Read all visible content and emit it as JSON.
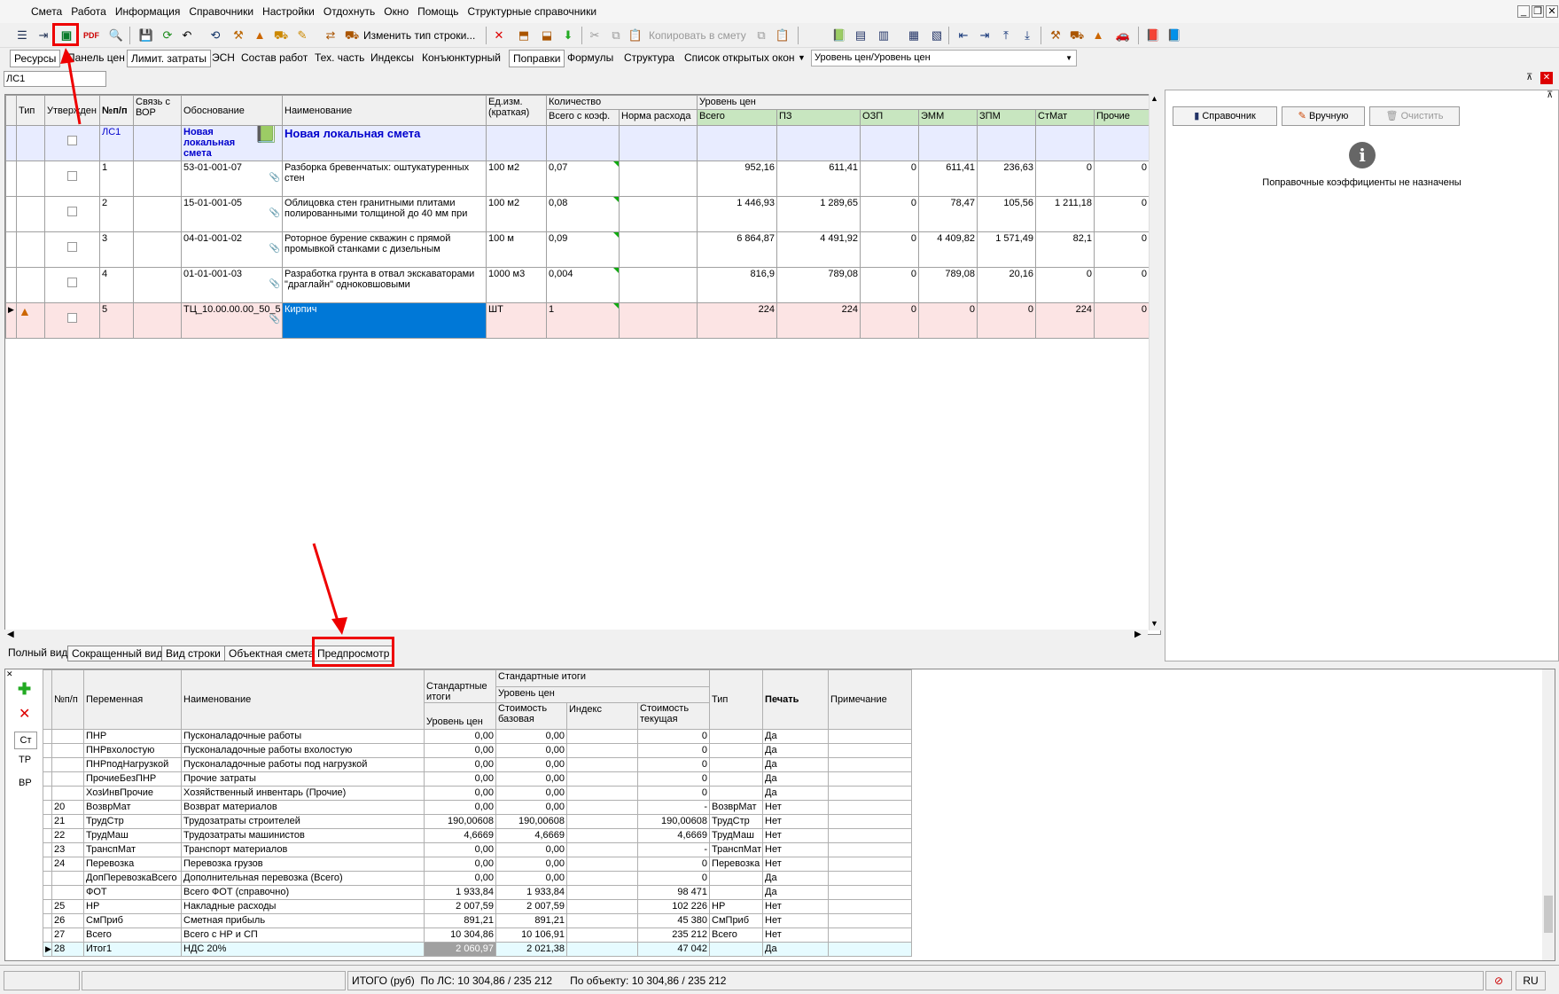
{
  "menu": [
    "Смета",
    "Работа",
    "Информация",
    "Справочники",
    "Настройки",
    "Отдохнуть",
    "Окно",
    "Помощь",
    "Структурные справочники"
  ],
  "toolbar1": {
    "change_row_type": "Изменить тип строки...",
    "copy_to_estimate": "Копировать в смету"
  },
  "toolbar2": {
    "tabs": [
      "Ресурсы",
      "Панель цен",
      "Лимит. затраты",
      "ЭСН",
      "Состав работ",
      "Тех. часть",
      "Индексы",
      "Конъюнктурный",
      "Поправки",
      "Формулы",
      "Структура",
      "Список открытых окон"
    ],
    "price_level": "Уровень цен/Уровень цен"
  },
  "address": "ЛС1",
  "grid": {
    "headers": {
      "type": "Тип",
      "approved": "Утвержден",
      "num": "№п/п",
      "bor": "Связь с ВОР",
      "basis": "Обоснование",
      "name": "Наименование",
      "unit": "Ед.изм. (краткая)",
      "qty": "Количество",
      "qty_total": "Всего с коэф.",
      "qty_norm": "Норма расхода",
      "level": "Уровень цен",
      "total": "Всего",
      "pz": "ПЗ",
      "ozp": "ОЗП",
      "emm": "ЭММ",
      "zpm": "ЗПМ",
      "stmat": "СтМат",
      "other": "Прочие"
    },
    "header_row": {
      "num": "ЛС1",
      "basis": "Новая локальная смета",
      "name": "Новая локальная смета"
    },
    "rows": [
      {
        "num": "1",
        "basis": "53-01-001-07",
        "name": "Разборка бревенчатых: оштукатуренных стен",
        "unit": "100 м2",
        "qty": "0,07",
        "total": "952,16",
        "pz": "611,41",
        "ozp": "0",
        "emm": "611,41",
        "zpm": "236,63",
        "stmat": "0",
        "other": "0"
      },
      {
        "num": "2",
        "basis": "15-01-001-05",
        "name": "Облицовка стен гранитными плитами полированными толщиной до 40 мм при",
        "unit": "100 м2",
        "qty": "0,08",
        "total": "1 446,93",
        "pz": "1 289,65",
        "ozp": "0",
        "emm": "78,47",
        "zpm": "105,56",
        "stmat": "1 211,18",
        "other": "0"
      },
      {
        "num": "3",
        "basis": "04-01-001-02",
        "name": "Роторное бурение скважин с прямой промывкой станками с дизельным",
        "unit": "100 м",
        "qty": "0,09",
        "total": "6 864,87",
        "pz": "4 491,92",
        "ozp": "0",
        "emm": "4 409,82",
        "zpm": "1 571,49",
        "stmat": "82,1",
        "other": "0"
      },
      {
        "num": "4",
        "basis": "01-01-001-03",
        "name": "Разработка грунта в отвал экскаваторами \"драглайн\" одноковшовыми",
        "unit": "1000 м3",
        "qty": "0,004",
        "total": "816,9",
        "pz": "789,08",
        "ozp": "0",
        "emm": "789,08",
        "zpm": "20,16",
        "stmat": "0",
        "other": "0"
      },
      {
        "num": "5",
        "basis": "ТЦ_10.00.00.00_50_5",
        "name": "Кирпич",
        "unit": "ШТ",
        "qty": "1",
        "total": "224",
        "pz": "224",
        "ozp": "0",
        "emm": "0",
        "zpm": "0",
        "stmat": "224",
        "other": "0"
      }
    ]
  },
  "bottom_tabs": [
    "Полный вид",
    "Сокращенный вид",
    "Вид строки",
    "Объектная смета",
    "Предпросмотр"
  ],
  "right_panel": {
    "btn_ref": "Справочник",
    "btn_manual": "Вручную",
    "btn_clear": "Очистить",
    "message": "Поправочные коэффициенты не назначены"
  },
  "side_tabs": [
    "Ст",
    "ТР",
    "ВР"
  ],
  "btable": {
    "headers": {
      "num": "№п/п",
      "var": "Переменная",
      "name": "Наименование",
      "std": "Стандартные итоги",
      "std_level": "Уровень цен",
      "std2": "Стандартные итоги",
      "level2": "Уровень цен",
      "base": "Стоимость базовая",
      "index": "Индекс",
      "current": "Стоимость текущая",
      "type": "Тип",
      "print": "Печать",
      "note": "Примечание"
    },
    "rows": [
      {
        "num": "",
        "var": "ПНР",
        "name": "Пусконаладочные работы",
        "std": "0,00",
        "base": "0,00",
        "index": "",
        "current": "0",
        "type": "",
        "print": "Да"
      },
      {
        "num": "",
        "var": "ПНРвхолостую",
        "name": "Пусконаладочные работы вхолостую",
        "std": "0,00",
        "base": "0,00",
        "index": "",
        "current": "0",
        "type": "",
        "print": "Да"
      },
      {
        "num": "",
        "var": "ПНРподНагрузкой",
        "name": "Пусконаладочные работы под нагрузкой",
        "std": "0,00",
        "base": "0,00",
        "index": "",
        "current": "0",
        "type": "",
        "print": "Да"
      },
      {
        "num": "",
        "var": "ПрочиеБезПНР",
        "name": "Прочие затраты",
        "std": "0,00",
        "base": "0,00",
        "index": "",
        "current": "0",
        "type": "",
        "print": "Да"
      },
      {
        "num": "",
        "var": "ХозИнвПрочие",
        "name": "Хозяйственный инвентарь (Прочие)",
        "std": "0,00",
        "base": "0,00",
        "index": "",
        "current": "0",
        "type": "",
        "print": "Да"
      },
      {
        "num": "20",
        "var": "ВозврМат",
        "name": "Возврат материалов",
        "std": "0,00",
        "base": "0,00",
        "index": "",
        "current": "-",
        "type": "ВозврМат",
        "print": "Нет"
      },
      {
        "num": "21",
        "var": "ТрудСтр",
        "name": "Трудозатраты строителей",
        "std": "190,00608",
        "base": "190,00608",
        "index": "",
        "current": "190,00608",
        "type": "ТрудСтр",
        "print": "Нет"
      },
      {
        "num": "22",
        "var": "ТрудМаш",
        "name": "Трудозатраты машинистов",
        "std": "4,6669",
        "base": "4,6669",
        "index": "",
        "current": "4,6669",
        "type": "ТрудМаш",
        "print": "Нет"
      },
      {
        "num": "23",
        "var": "ТранспМат",
        "name": "Транспорт материалов",
        "std": "0,00",
        "base": "0,00",
        "index": "",
        "current": "-",
        "type": "ТранспМат",
        "print": "Нет"
      },
      {
        "num": "24",
        "var": "Перевозка",
        "name": "Перевозка грузов",
        "std": "0,00",
        "base": "0,00",
        "index": "",
        "current": "0",
        "type": "Перевозка",
        "print": "Нет"
      },
      {
        "num": "",
        "var": "ДопПеревозкаВсего",
        "name": "Дополнительная перевозка (Всего)",
        "std": "0,00",
        "base": "0,00",
        "index": "",
        "current": "0",
        "type": "",
        "print": "Да"
      },
      {
        "num": "",
        "var": "ФОТ",
        "name": "Всего ФОТ (справочно)",
        "std": "1 933,84",
        "base": "1 933,84",
        "index": "",
        "current": "98 471",
        "type": "",
        "print": "Да"
      },
      {
        "num": "25",
        "var": "НР",
        "name": "Накладные расходы",
        "std": "2 007,59",
        "base": "2 007,59",
        "index": "",
        "current": "102 226",
        "type": "НР",
        "print": "Нет"
      },
      {
        "num": "26",
        "var": "СмПриб",
        "name": "Сметная прибыль",
        "std": "891,21",
        "base": "891,21",
        "index": "",
        "current": "45 380",
        "type": "СмПриб",
        "print": "Нет"
      },
      {
        "num": "27",
        "var": "Всего",
        "name": "Всего с НР и СП",
        "std": "10 304,86",
        "base": "10 106,91",
        "index": "",
        "current": "235 212",
        "type": "Всего",
        "print": "Нет"
      },
      {
        "num": "28",
        "var": "Итог1",
        "name": "НДС 20%",
        "std": "2 060,97",
        "base": "2 021,38",
        "index": "",
        "current": "47 042",
        "type": "",
        "print": "Да"
      }
    ]
  },
  "status": {
    "itogo": "ИТОГО (руб)",
    "by_ls": "По ЛС: 10 304,86 / 235 212",
    "by_object": "По объекту: 10 304,86 / 235 212",
    "lang": "RU"
  }
}
